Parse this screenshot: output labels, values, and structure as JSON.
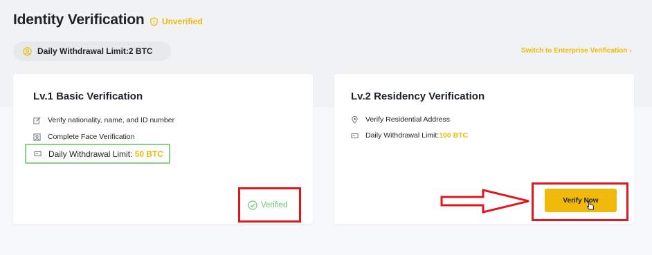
{
  "header": {
    "title": "Identity Verification",
    "status": "Unverified",
    "daily_limit": "Daily Withdrawal Limit:2 BTC",
    "enterprise_link": "Switch to Enterprise Verification  ›"
  },
  "level1": {
    "title": "Lv.1 Basic Verification",
    "items": [
      "Verify nationality, name, and ID number",
      "Complete Face Verification"
    ],
    "limit_label": "Daily Withdrawal Limit:",
    "limit_value": "50 BTC",
    "status": "Verified"
  },
  "level2": {
    "title": "Lv.2 Residency Verification",
    "items": [
      "Verify Residential Address"
    ],
    "limit_label": "Daily Withdrawal Limit:",
    "limit_value": "100 BTC",
    "button": "Verify Now"
  },
  "colors": {
    "accent": "#f0b90b",
    "success": "#6cc26c",
    "annotation_red": "#e3161d",
    "highlight_green": "#8ad18a"
  },
  "icons": [
    "shield-icon",
    "user-circle-icon",
    "edit-icon",
    "face-id-icon",
    "card-icon",
    "location-icon",
    "check-circle-icon",
    "hand-cursor-icon"
  ]
}
